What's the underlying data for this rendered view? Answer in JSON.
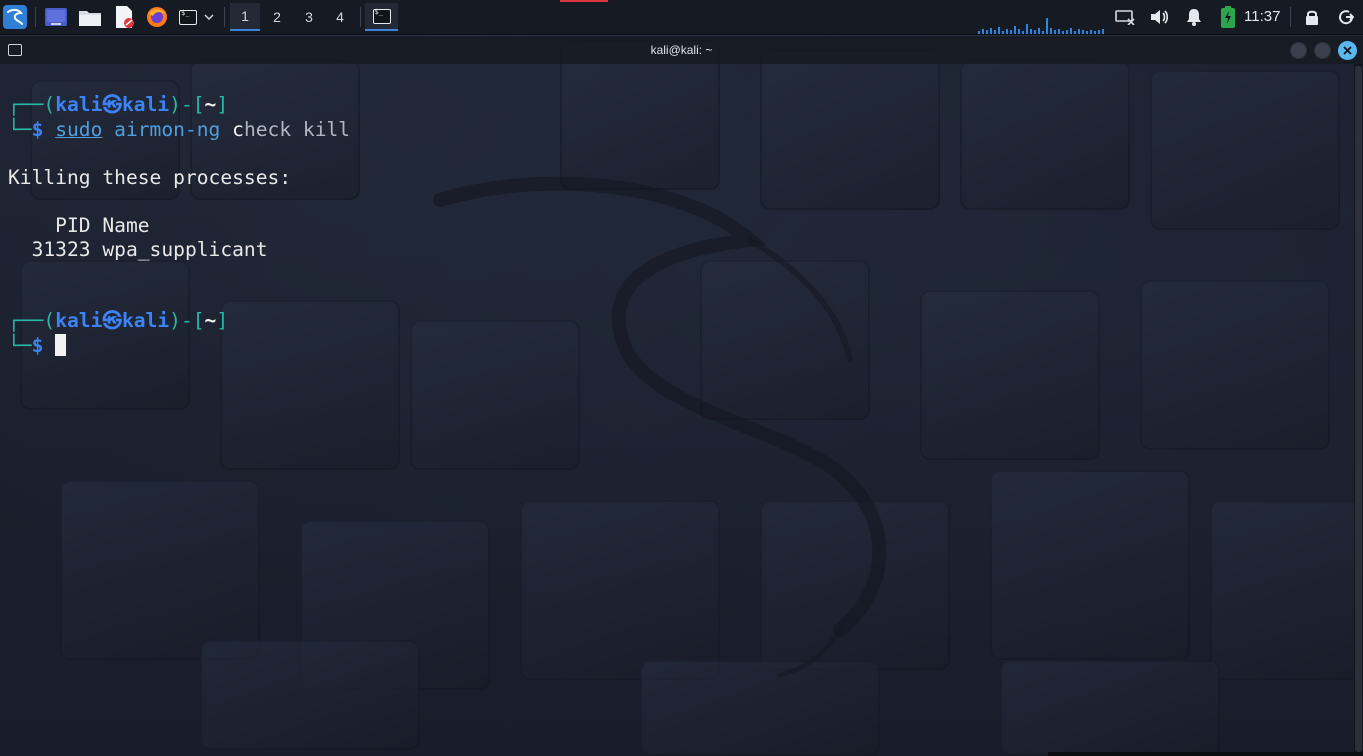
{
  "panel": {
    "workspaces": [
      "1",
      "2",
      "3",
      "4"
    ],
    "active_workspace": "1",
    "clock": "11:37",
    "icons": {
      "menu": "kali-menu-icon",
      "desktop": "show-desktop-icon",
      "files": "file-manager-icon",
      "editor": "text-editor-icon",
      "browser": "firefox-icon",
      "terminal": "terminal-icon",
      "network": "network-icon",
      "volume": "volume-icon",
      "notifications": "bell-icon",
      "battery": "battery-icon",
      "lock": "lock-icon",
      "logout": "power-icon"
    }
  },
  "window": {
    "title": "kali@kali: ~"
  },
  "terminal": {
    "prompt1": {
      "frame_top": "┌──(",
      "user": "kali",
      "at": "㉿",
      "host": "kali",
      "close_user": ")-[",
      "dir": "~",
      "close_dir": "]",
      "frame_bottom": "└─",
      "dollar": "$",
      "cmd_sudo": "sudo",
      "cmd_prog": "airmon-ng",
      "arg_first": "c",
      "arg_rest": "heck kill"
    },
    "output": {
      "line1": "Killing these processes:",
      "header": "    PID Name",
      "row": "  31323 wpa_supplicant"
    },
    "prompt2": {
      "frame_top": "┌──(",
      "user": "kali",
      "at": "㉿",
      "host": "kali",
      "close_user": ")-[",
      "dir": "~",
      "close_dir": "]",
      "frame_bottom": "└─",
      "dollar": "$"
    }
  },
  "colors": {
    "accent": "#3e84d8",
    "prompt_frame": "#28b8a6",
    "prompt_user": "#3b83f6",
    "command": "#4d9fe0",
    "close_button": "#5bb7f0"
  }
}
